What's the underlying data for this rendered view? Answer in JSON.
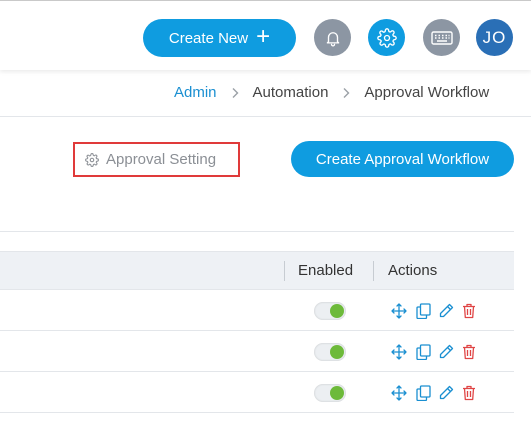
{
  "header": {
    "create_new_label": "Create New",
    "create_new_plus": "+",
    "avatar_initials": "JO"
  },
  "breadcrumb": {
    "items": [
      "Admin",
      "Automation",
      "Approval Workflow"
    ]
  },
  "toolbar": {
    "approval_setting_label": "Approval Setting",
    "create_workflow_label": "Create Approval Workflow"
  },
  "table": {
    "columns": [
      "Enabled",
      "Actions"
    ],
    "rows": [
      {
        "enabled": true
      },
      {
        "enabled": true
      },
      {
        "enabled": true
      }
    ]
  },
  "colors": {
    "accent": "#0f9ce0",
    "toggle_on": "#6dba3a",
    "delete": "#e04545",
    "highlight_border": "#e03a3a"
  },
  "icons": {
    "header": [
      "bell-icon",
      "gear-icon",
      "keyboard-icon"
    ],
    "actions": [
      "move-icon",
      "copy-icon",
      "edit-icon",
      "delete-icon"
    ]
  }
}
